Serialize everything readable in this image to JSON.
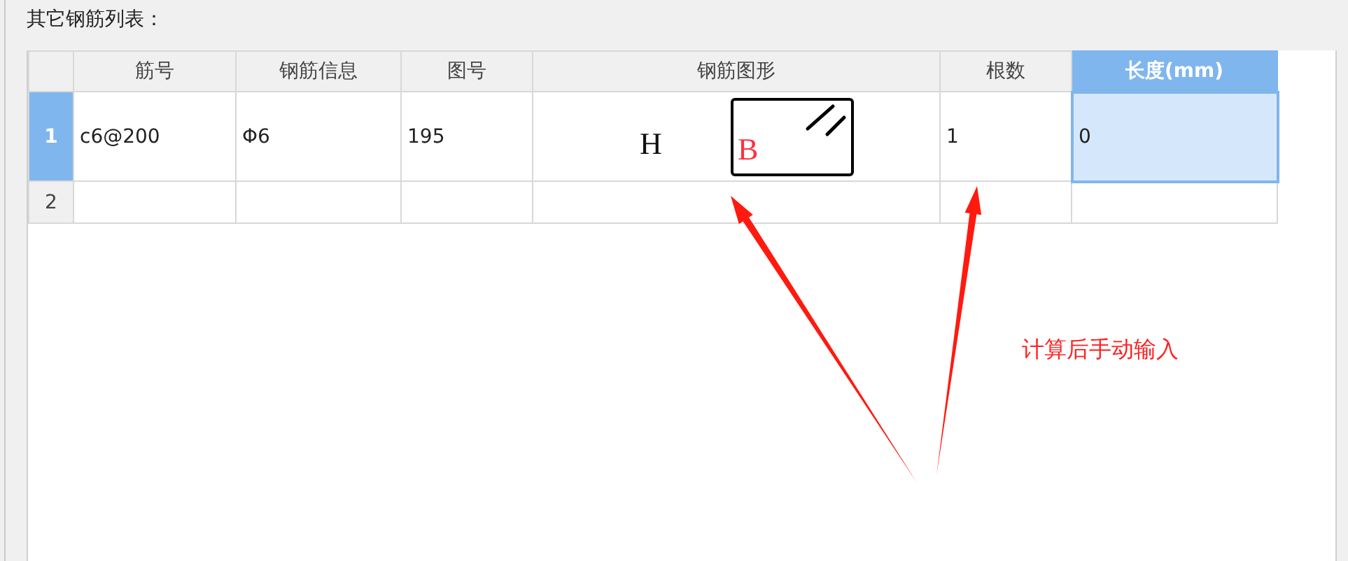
{
  "section_title": "其它钢筋列表：",
  "table": {
    "columns": [
      {
        "label": "筋号",
        "selected": false
      },
      {
        "label": "钢筋信息",
        "selected": false
      },
      {
        "label": "图号",
        "selected": false
      },
      {
        "label": "钢筋图形",
        "selected": false
      },
      {
        "label": "根数",
        "selected": false
      },
      {
        "label": "长度(mm)",
        "selected": true
      }
    ],
    "rows": [
      {
        "number": "1",
        "selected": true,
        "cells": [
          {
            "kind": "text",
            "text": "c6@200",
            "selected": false
          },
          {
            "kind": "text",
            "text": "Φ6",
            "selected": false
          },
          {
            "kind": "text",
            "text": "195",
            "selected": false
          },
          {
            "kind": "shape",
            "left_label": "H",
            "inner_label": "B",
            "selected": false
          },
          {
            "kind": "text",
            "text": "1",
            "selected": false
          },
          {
            "kind": "text",
            "text": "0",
            "selected": true
          }
        ]
      },
      {
        "number": "2",
        "selected": false,
        "cells": [
          {
            "kind": "text",
            "text": "",
            "selected": false
          },
          {
            "kind": "text",
            "text": "",
            "selected": false
          },
          {
            "kind": "text",
            "text": "",
            "selected": false
          },
          {
            "kind": "text",
            "text": "",
            "selected": false
          },
          {
            "kind": "text",
            "text": "",
            "selected": false
          },
          {
            "kind": "text",
            "text": "",
            "selected": false
          }
        ]
      }
    ]
  },
  "annotation": {
    "text": "计算后手动输入"
  }
}
